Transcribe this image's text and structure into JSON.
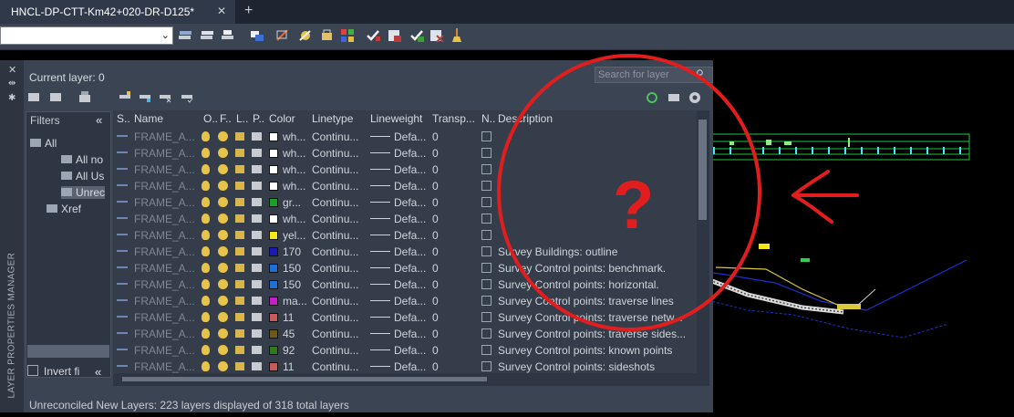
{
  "tab": {
    "title": "HNCL-DP-CTT-Km42+020-DR-D125*",
    "close": "✕",
    "new_tab": "+"
  },
  "panel": {
    "vertical_title": "LAYER PROPERTIES MANAGER",
    "current_layer": "Current layer: 0",
    "search_placeholder": "Search for layer",
    "status": "Unreconciled New Layers: 223 layers displayed of 318 total layers"
  },
  "filters": {
    "header": "Filters",
    "collapse": "«",
    "tree": [
      {
        "label": "All"
      },
      {
        "label": "All no"
      },
      {
        "label": "All Us"
      },
      {
        "label": "Unrec"
      },
      {
        "label": "Xref"
      }
    ],
    "invert": "Invert fi"
  },
  "columns": [
    "S..",
    "Name",
    "O..",
    "F..",
    "L..",
    "P..",
    "Color",
    "Linetype",
    "Lineweight",
    "Transp...",
    "N..",
    "Description"
  ],
  "rows": [
    {
      "name": "FRAME_A...",
      "color_name": "wh...",
      "color_hex": "#ffffff",
      "linetype": "Continu...",
      "lineweight": "Defa...",
      "transparency": "0",
      "description": ""
    },
    {
      "name": "FRAME_A...",
      "color_name": "wh...",
      "color_hex": "#ffffff",
      "linetype": "Continu...",
      "lineweight": "Defa...",
      "transparency": "0",
      "description": ""
    },
    {
      "name": "FRAME_A...",
      "color_name": "wh...",
      "color_hex": "#ffffff",
      "linetype": "Continu...",
      "lineweight": "Defa...",
      "transparency": "0",
      "description": ""
    },
    {
      "name": "FRAME_A...",
      "color_name": "wh...",
      "color_hex": "#ffffff",
      "linetype": "Continu...",
      "lineweight": "Defa...",
      "transparency": "0",
      "description": ""
    },
    {
      "name": "FRAME_A...",
      "color_name": "gr...",
      "color_hex": "#1aa12a",
      "linetype": "Continu...",
      "lineweight": "Defa...",
      "transparency": "0",
      "description": ""
    },
    {
      "name": "FRAME_A...",
      "color_name": "wh...",
      "color_hex": "#ffffff",
      "linetype": "Continu...",
      "lineweight": "Defa...",
      "transparency": "0",
      "description": ""
    },
    {
      "name": "FRAME_A...",
      "color_name": "yel...",
      "color_hex": "#f5e81a",
      "linetype": "Continu...",
      "lineweight": "Defa...",
      "transparency": "0",
      "description": ""
    },
    {
      "name": "FRAME_A...",
      "color_name": "170",
      "color_hex": "#1a1ab8",
      "linetype": "Continu...",
      "lineweight": "Defa...",
      "transparency": "0",
      "description": "Survey Buildings: outline"
    },
    {
      "name": "FRAME_A...",
      "color_name": "150",
      "color_hex": "#1f6fd6",
      "linetype": "Continu...",
      "lineweight": "Defa...",
      "transparency": "0",
      "description": "Survey Control points: benchmark."
    },
    {
      "name": "FRAME_A...",
      "color_name": "150",
      "color_hex": "#1f6fd6",
      "linetype": "Continu...",
      "lineweight": "Defa...",
      "transparency": "0",
      "description": "Survey Control points: horizontal."
    },
    {
      "name": "FRAME_A...",
      "color_name": "ma...",
      "color_hex": "#c81ec8",
      "linetype": "Continu...",
      "lineweight": "Defa...",
      "transparency": "0",
      "description": "Survey Control points: traverse lines"
    },
    {
      "name": "FRAME_A...",
      "color_name": "11",
      "color_hex": "#c85a5a",
      "linetype": "Continu...",
      "lineweight": "Defa...",
      "transparency": "0",
      "description": "Survey  Control  points:  traverse  netw..."
    },
    {
      "name": "FRAME_A...",
      "color_name": "45",
      "color_hex": "#6b5a18",
      "linetype": "Continu...",
      "lineweight": "Defa...",
      "transparency": "0",
      "description": "Survey  Control  points:  traverse  sides..."
    },
    {
      "name": "FRAME_A...",
      "color_name": "92",
      "color_hex": "#2e7a1e",
      "linetype": "Continu...",
      "lineweight": "Defa...",
      "transparency": "0",
      "description": "Survey Control points: known points"
    },
    {
      "name": "FRAME_A...",
      "color_name": "11",
      "color_hex": "#c85a5a",
      "linetype": "Continu...",
      "lineweight": "Defa...",
      "transparency": "0",
      "description": "Survey Control points: sideshots"
    }
  ],
  "annotation": {
    "mark": "?"
  }
}
